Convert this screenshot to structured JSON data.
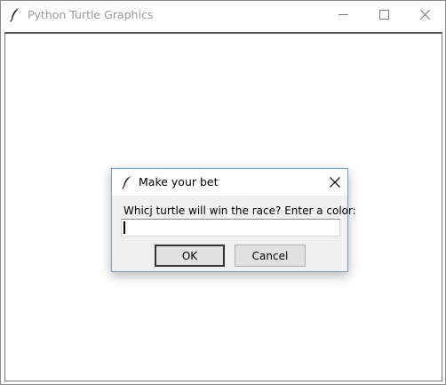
{
  "window": {
    "title": "Python Turtle Graphics",
    "icon": "feather-icon",
    "controls": [
      "minimize-icon",
      "maximize-icon",
      "close-icon"
    ]
  },
  "dialog": {
    "title": "Make your bet",
    "icon": "feather-icon",
    "prompt": "Whicj turtle will win the race? Enter a color:",
    "input_value": "",
    "ok_label": "OK",
    "cancel_label": "Cancel"
  },
  "colors": {
    "window_bg": "#ffffff",
    "dialog_bg": "#f0f0f0",
    "button_bg": "#e1e1e1",
    "title_inactive": "#999999"
  }
}
